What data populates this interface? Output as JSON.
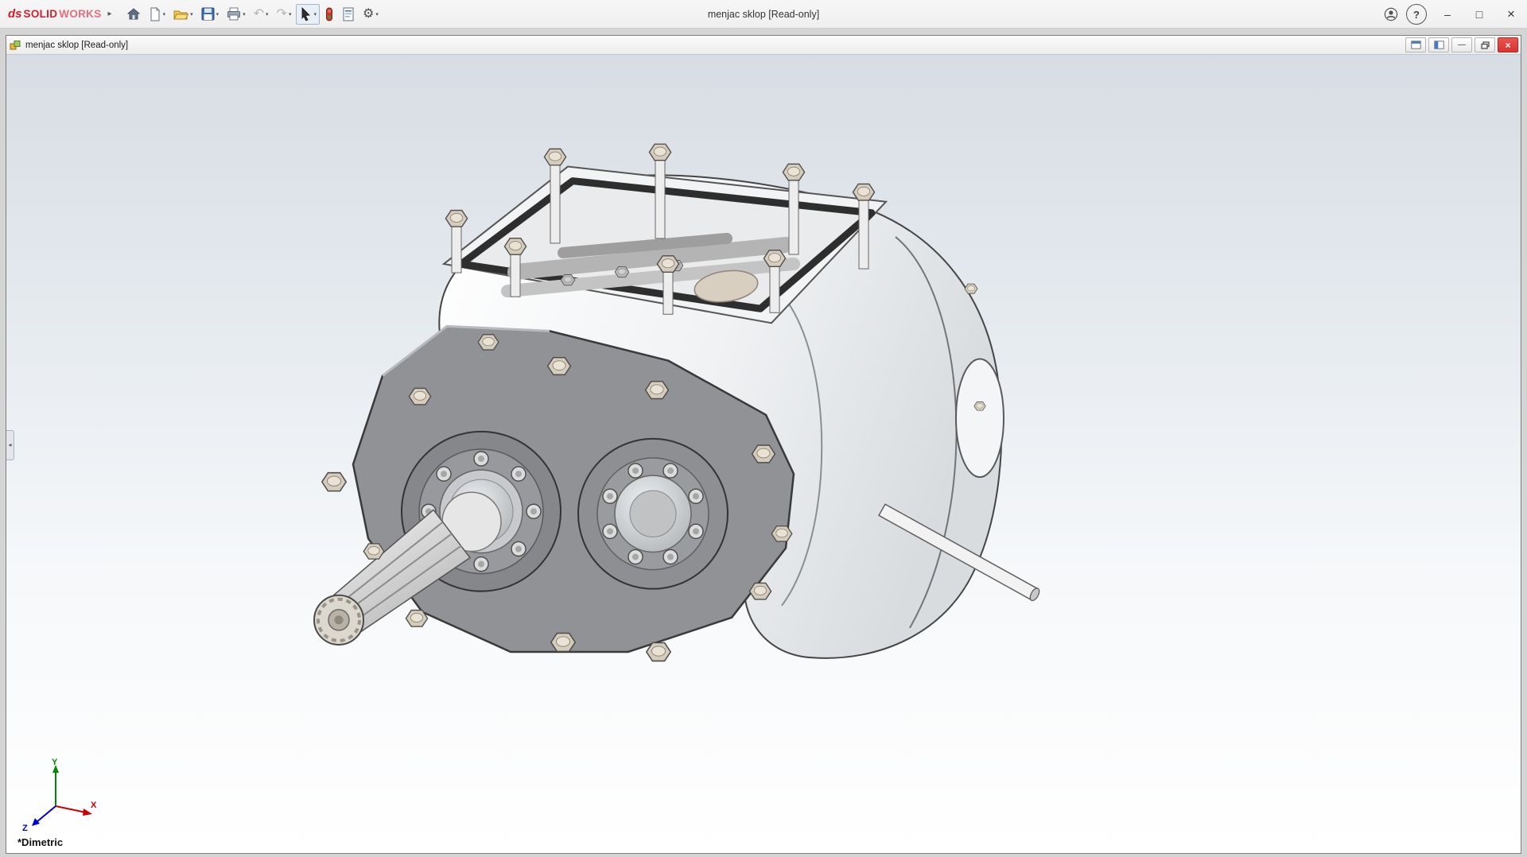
{
  "titlebar": {
    "brand": {
      "logo_text": "ds",
      "bold": "SOLID",
      "light": "WORKS"
    },
    "expand_glyph": "▸",
    "title": "menjac sklop [Read-only]",
    "controls": {
      "help": "?",
      "minimize": "–",
      "maximize": "□",
      "close": "×"
    }
  },
  "toolbar": {
    "dropdown_glyph": "▾",
    "icons": {
      "undo": "↶",
      "redo": "↷",
      "options": "⚙"
    },
    "items": [
      "home",
      "new-document",
      "open",
      "save",
      "print",
      "undo",
      "redo",
      "select",
      "rebuild",
      "file-properties",
      "options"
    ]
  },
  "document_window": {
    "title": "menjac sklop [Read-only]",
    "controls": {
      "minimize": "—",
      "close": "×"
    }
  },
  "viewport": {
    "orientation_label": "*Dimetric",
    "triad": {
      "x": "X",
      "y": "Y",
      "z": "Z"
    },
    "colors": {
      "bg_top": "#d7dde4",
      "bg_bottom": "#ffffff",
      "plate_gray": "#909296",
      "bolt_tan": "#d6ccbb",
      "close_red": "#d9342f",
      "axis_x": "#cc0000",
      "axis_y": "#008800",
      "axis_z": "#0000cc"
    }
  },
  "left_panel": {
    "collapse_glyph": "◂"
  }
}
